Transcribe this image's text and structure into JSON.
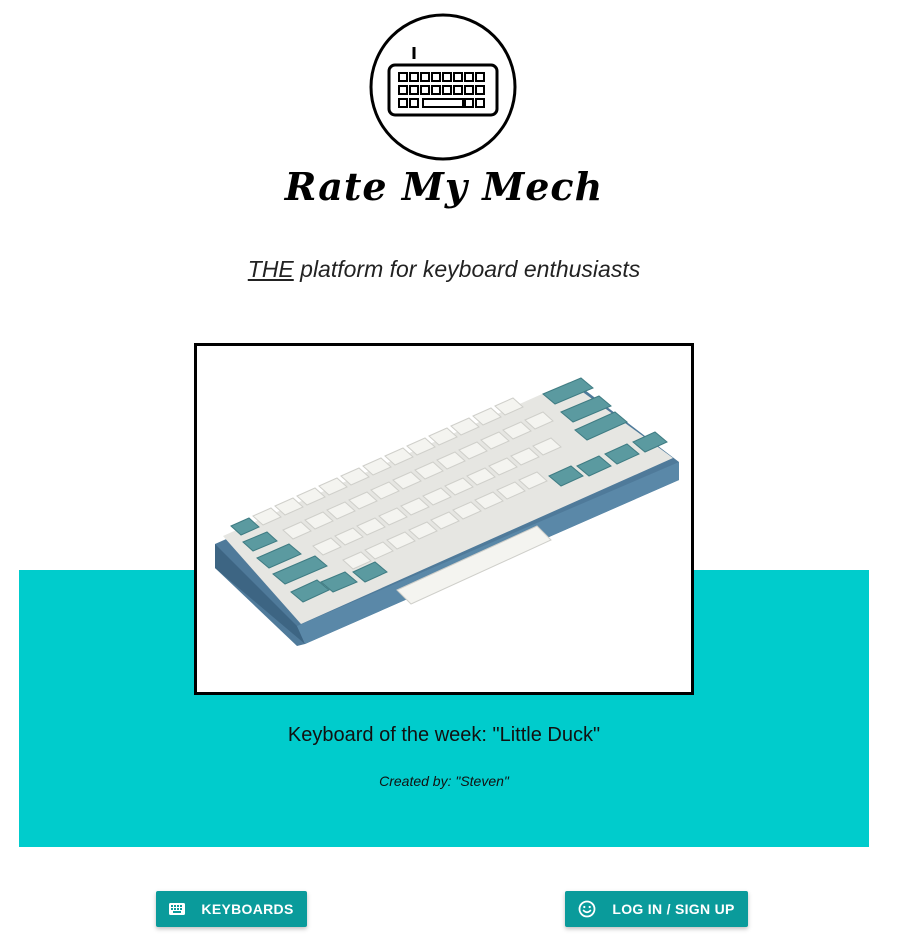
{
  "brand": {
    "name": "Rate My Mech"
  },
  "tagline": {
    "emphasis": "THE",
    "rest": "platform for keyboard enthusiasts"
  },
  "keyboard_of_week": {
    "title": "Keyboard of the week: \"Little Duck\"",
    "creator": "Created by: \"Steven\""
  },
  "actions": {
    "keyboards_label": "KEYBOARDS",
    "login_label": "LOG IN / SIGN UP"
  },
  "icons": {
    "logo": "keyboard-logo-icon",
    "keyboards": "keyboard-icon",
    "login": "smiley-icon"
  },
  "colors": {
    "teal_band": "#00cccc",
    "button": "#0a9b9b",
    "keycap_accent": "#5b9aa0",
    "keycap_base": "#f2f2ee",
    "case": "#4f7a9a"
  }
}
